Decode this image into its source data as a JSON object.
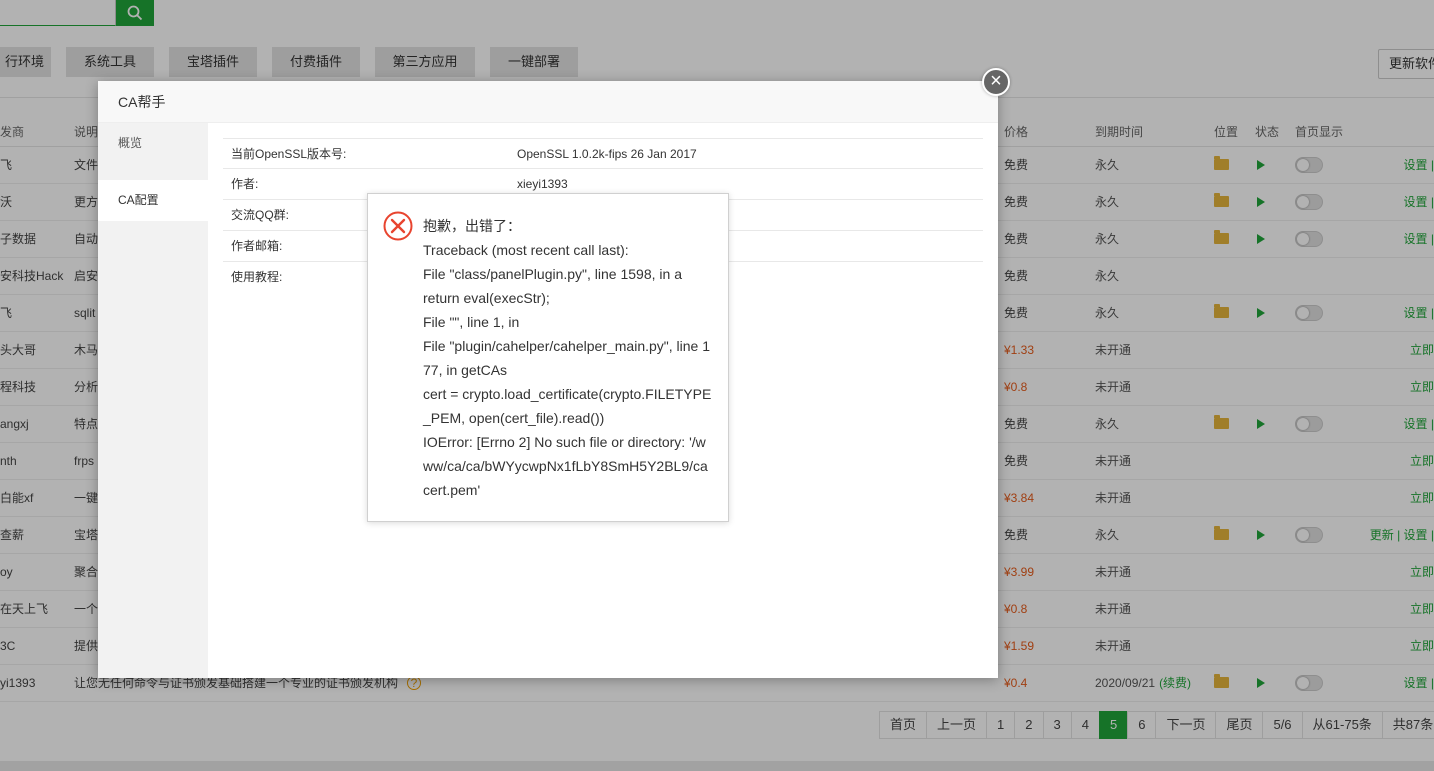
{
  "background": {
    "categories": [
      "行环境",
      "系统工具",
      "宝塔插件",
      "付费插件",
      "第三方应用",
      "一键部署"
    ],
    "update_button": "更新软件",
    "columns": {
      "developer": "发商",
      "description": "说明",
      "price": "价格",
      "expiry": "到期时间",
      "location": "位置",
      "status": "状态",
      "homepage": "首页显示"
    },
    "rows": [
      {
        "dev": "飞",
        "desc": "文件",
        "price": "免费",
        "exp": "永久",
        "icons": true,
        "action": "设置 |"
      },
      {
        "dev": "沃",
        "desc": "更方",
        "price": "免费",
        "exp": "永久",
        "icons": true,
        "action": "设置 |"
      },
      {
        "dev": "子数据",
        "desc": "自动",
        "price": "免费",
        "exp": "永久",
        "icons": true,
        "action": "设置 |"
      },
      {
        "dev": "安科技Hack",
        "desc": "启安",
        "price": "免费",
        "exp": "永久",
        "icons": false,
        "action": ""
      },
      {
        "dev": "飞",
        "desc": "sqlit",
        "price": "免费",
        "exp": "永久",
        "icons": true,
        "action": "设置 |"
      },
      {
        "dev": "头大哥",
        "desc": "木马",
        "price": "¥1.33",
        "exp": "未开通",
        "icons": false,
        "action": "立即"
      },
      {
        "dev": "程科技",
        "desc": "分析",
        "price": "¥0.8",
        "exp": "未开通",
        "icons": false,
        "action": "立即"
      },
      {
        "dev": "angxj",
        "desc": "特点",
        "price": "免费",
        "exp": "永久",
        "icons": true,
        "action": "设置 |"
      },
      {
        "dev": "nth",
        "desc": "frps",
        "price": "免费",
        "exp": "未开通",
        "icons": false,
        "action": "立即"
      },
      {
        "dev": "白能xf",
        "desc": "一键",
        "price": "¥3.84",
        "exp": "未开通",
        "icons": false,
        "action": "立即"
      },
      {
        "dev": "查薪",
        "desc": "宝塔",
        "price": "免费",
        "exp": "永久",
        "icons": true,
        "action": "更新 | 设置 |"
      },
      {
        "dev": "oy",
        "desc": "聚合",
        "price": "¥3.99",
        "exp": "未开通",
        "icons": false,
        "action": "立即"
      },
      {
        "dev": "在天上飞",
        "desc": "一个",
        "price": "¥0.8",
        "exp": "未开通",
        "icons": false,
        "action": "立即"
      },
      {
        "dev": "3C",
        "desc": "提供",
        "price": "¥1.59",
        "exp": "未开通",
        "icons": false,
        "action": "立即"
      },
      {
        "dev": "yi1393",
        "desc": "让您无任何命令与证书颁发基础搭建一个专业的证书颁发机构",
        "price": "¥0.4",
        "exp": "2020/09/21",
        "renew": "(续费)",
        "icons": true,
        "action": "设置 |"
      }
    ],
    "pagination": [
      "首页",
      "上一页",
      "1",
      "2",
      "3",
      "4",
      "5",
      "6",
      "下一页",
      "尾页",
      "5/6",
      "从61-75条",
      "共87条"
    ],
    "current_page": "5"
  },
  "dialog": {
    "title": "CA帮手",
    "side_items": [
      "概览",
      "CA配置"
    ],
    "active_side": "CA配置",
    "info_rows": [
      {
        "key": "当前OpenSSL版本号:",
        "value": "OpenSSL 1.0.2k-fips 26 Jan 2017"
      },
      {
        "key": "作者:",
        "value": "xieyi1393"
      },
      {
        "key": "交流QQ群:",
        "value": ""
      },
      {
        "key": "作者邮箱:",
        "value": ""
      },
      {
        "key": "使用教程:",
        "value": ""
      }
    ]
  },
  "error": {
    "lines": [
      "抱歉，出错了：",
      "Traceback (most recent call last):",
      "File \"class/panelPlugin.py\", line 1598, in a",
      "return eval(execStr);",
      "File \"\", line 1, in",
      "File \"plugin/cahelper/cahelper_main.py\", line 177, in getCAs",
      "cert = crypto.load_certificate(crypto.FILETYPE_PEM, open(cert_file).read())",
      "IOError: [Errno 2] No such file or directory: '/www/ca/ca/bWYycwpNx1fLbY8SmH5Y2BL9/cacert.pem'"
    ]
  },
  "colors": {
    "accent": "#20a53a",
    "paid": "#e65b1a",
    "error": "#e8442f"
  }
}
